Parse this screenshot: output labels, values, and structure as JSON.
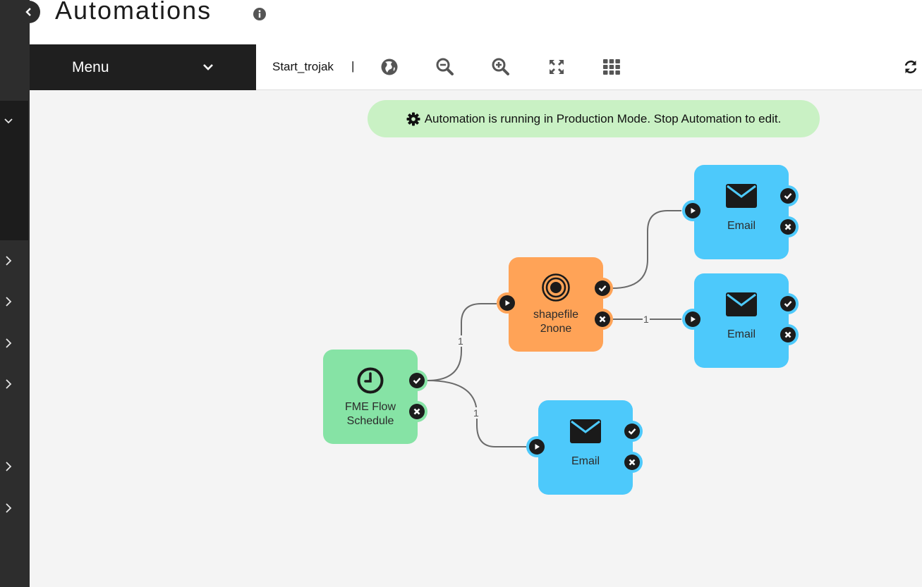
{
  "header": {
    "title": "Automations",
    "info_icon": "info-icon"
  },
  "toolbar": {
    "menu_label": "Menu",
    "flow_name": "Start_trojak",
    "separator": "|",
    "icons": [
      "globe-icon",
      "zoom-out-icon",
      "zoom-in-icon",
      "fit-screen-icon",
      "grid-icon",
      "refresh-icon"
    ]
  },
  "banner": {
    "text": "Automation is running in Production Mode. Stop Automation to edit.",
    "icon": "gear-icon"
  },
  "nodes": {
    "schedule": {
      "label_line1": "FME Flow",
      "label_line2": "Schedule",
      "icon": "clock-icon",
      "color": "#86e3a5"
    },
    "workspace": {
      "label_line1": "shapefile",
      "label_line2": "2none",
      "icon": "target-icon",
      "color": "#ffa357"
    },
    "email_top": {
      "label": "Email",
      "icon": "envelope-icon",
      "color": "#4dc9fb"
    },
    "email_mid": {
      "label": "Email",
      "icon": "envelope-icon",
      "color": "#4dc9fb"
    },
    "email_bottom": {
      "label": "Email",
      "icon": "envelope-icon",
      "color": "#4dc9fb"
    }
  },
  "edges": {
    "schedule_to_workspace": "1",
    "schedule_to_email": "1",
    "workspace_fail_to_email": "1"
  }
}
